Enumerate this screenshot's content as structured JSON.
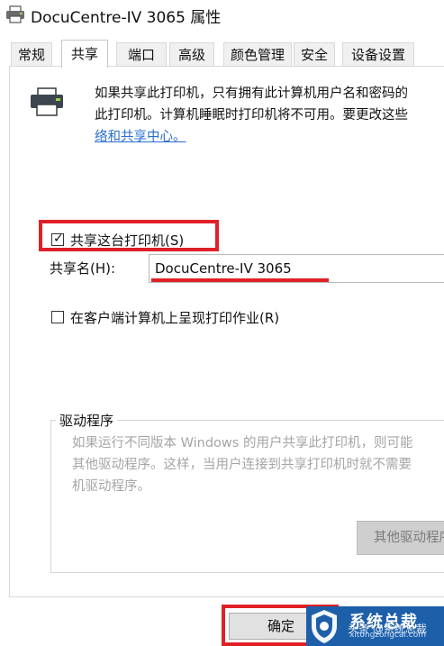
{
  "window": {
    "title": "DocuCentre-IV 3065 属性"
  },
  "tabs": [
    {
      "label": "常规"
    },
    {
      "label": "共享",
      "active": true
    },
    {
      "label": "端口"
    },
    {
      "label": "高级"
    },
    {
      "label": "颜色管理"
    },
    {
      "label": "安全"
    },
    {
      "label": "设备设置"
    }
  ],
  "sharing": {
    "description_line1": "如果共享此打印机，只有拥有此计算机用户名和密码的",
    "description_line2": "此打印机。计算机睡眠时打印机将不可用。要更改这些",
    "description_link": "络和共享中心。",
    "share_checkbox_label": "共享这台打印机(S)",
    "share_checked": true,
    "share_name_label": "共享名(H):",
    "share_name_value": "DocuCentre-IV 3065",
    "render_jobs_label": "在客户端计算机上呈现打印作业(R)",
    "render_jobs_checked": false
  },
  "drivers": {
    "group_title": "驱动程序",
    "text_line1": "如果运行不同版本 Windows 的用户共享此打印机，则可能",
    "text_line2": "其他驱动程序。这样，当用户连接到共享打印机时就不需要",
    "text_line3": "机驱动程序。",
    "other_drivers_button": "其他驱动程序"
  },
  "footer": {
    "ok_button": "确定"
  },
  "watermark": {
    "title": "系统总裁",
    "subtitle": "xitongzongcai.com",
    "overlay": "头条 @系统总裁"
  },
  "colors": {
    "highlight_red": "#e02027",
    "link_blue": "#2a6fd0",
    "watermark_blue": "#1d5fa8"
  }
}
